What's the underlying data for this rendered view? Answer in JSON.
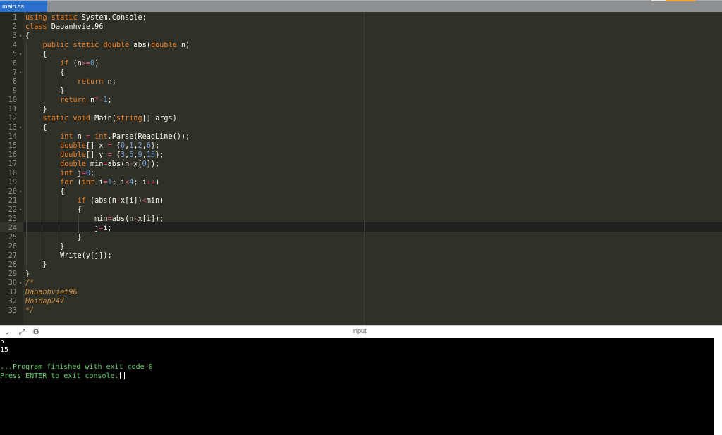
{
  "tabs": [
    {
      "label": "main.cs",
      "active": true
    }
  ],
  "colors": {
    "editor_bg": "#2f3129",
    "gutter_bg": "#272822",
    "keyword": "#ec7a1a",
    "number": "#6f9ad8",
    "operator": "#cf4a79",
    "comment": "#c98a3a",
    "tab_active": "#2b6fcc",
    "console_text": "#6cd26c"
  },
  "editor": {
    "active_line": 24,
    "lines": [
      {
        "n": "1",
        "fold": false,
        "indent": 0,
        "tokens": [
          [
            "kw",
            "using"
          ],
          [
            "pl",
            " "
          ],
          [
            "kw",
            "static"
          ],
          [
            "pl",
            " System.Console;"
          ]
        ]
      },
      {
        "n": "2",
        "fold": false,
        "indent": 0,
        "tokens": [
          [
            "kw",
            "class"
          ],
          [
            "pl",
            " Daoanhviet96"
          ]
        ]
      },
      {
        "n": "3",
        "fold": true,
        "indent": 0,
        "tokens": [
          [
            "pl",
            "{"
          ]
        ]
      },
      {
        "n": "4",
        "fold": false,
        "indent": 1,
        "tokens": [
          [
            "pl",
            "    "
          ],
          [
            "kw",
            "public"
          ],
          [
            "pl",
            " "
          ],
          [
            "kw",
            "static"
          ],
          [
            "pl",
            " "
          ],
          [
            "ty",
            "double"
          ],
          [
            "pl",
            " abs("
          ],
          [
            "ty",
            "double"
          ],
          [
            "pl",
            " n)"
          ]
        ]
      },
      {
        "n": "5",
        "fold": true,
        "indent": 1,
        "tokens": [
          [
            "pl",
            "    {"
          ]
        ]
      },
      {
        "n": "6",
        "fold": false,
        "indent": 2,
        "tokens": [
          [
            "pl",
            "        "
          ],
          [
            "kw",
            "if"
          ],
          [
            "pl",
            " (n"
          ],
          [
            "op",
            ">="
          ],
          [
            "nu",
            "0"
          ],
          [
            "pl",
            ")"
          ]
        ]
      },
      {
        "n": "7",
        "fold": true,
        "indent": 2,
        "tokens": [
          [
            "pl",
            "        {"
          ]
        ]
      },
      {
        "n": "8",
        "fold": false,
        "indent": 3,
        "tokens": [
          [
            "pl",
            "            "
          ],
          [
            "kw",
            "return"
          ],
          [
            "pl",
            " n;"
          ]
        ]
      },
      {
        "n": "9",
        "fold": false,
        "indent": 2,
        "tokens": [
          [
            "pl",
            "        }"
          ]
        ]
      },
      {
        "n": "10",
        "fold": false,
        "indent": 2,
        "tokens": [
          [
            "pl",
            "        "
          ],
          [
            "kw",
            "return"
          ],
          [
            "pl",
            " n"
          ],
          [
            "op",
            "*-"
          ],
          [
            "nu",
            "1"
          ],
          [
            "pl",
            ";"
          ]
        ]
      },
      {
        "n": "11",
        "fold": false,
        "indent": 1,
        "tokens": [
          [
            "pl",
            "    }"
          ]
        ]
      },
      {
        "n": "12",
        "fold": false,
        "indent": 1,
        "tokens": [
          [
            "pl",
            "    "
          ],
          [
            "kw",
            "static"
          ],
          [
            "pl",
            " "
          ],
          [
            "ty",
            "void"
          ],
          [
            "pl",
            " Main("
          ],
          [
            "ty",
            "string"
          ],
          [
            "pl",
            "[] args)"
          ]
        ]
      },
      {
        "n": "13",
        "fold": true,
        "indent": 1,
        "tokens": [
          [
            "pl",
            "    {"
          ]
        ]
      },
      {
        "n": "14",
        "fold": false,
        "indent": 2,
        "tokens": [
          [
            "pl",
            "        "
          ],
          [
            "ty",
            "int"
          ],
          [
            "pl",
            " n "
          ],
          [
            "op",
            "="
          ],
          [
            "pl",
            " "
          ],
          [
            "ty",
            "int"
          ],
          [
            "pl",
            ".Parse(ReadLine());"
          ]
        ]
      },
      {
        "n": "15",
        "fold": false,
        "indent": 2,
        "tokens": [
          [
            "pl",
            "        "
          ],
          [
            "ty",
            "double"
          ],
          [
            "pl",
            "[] x "
          ],
          [
            "op",
            "="
          ],
          [
            "pl",
            " {"
          ],
          [
            "nu",
            "0"
          ],
          [
            "pl",
            ","
          ],
          [
            "nu",
            "1"
          ],
          [
            "pl",
            ","
          ],
          [
            "nu",
            "2"
          ],
          [
            "pl",
            ","
          ],
          [
            "nu",
            "6"
          ],
          [
            "pl",
            "};"
          ]
        ]
      },
      {
        "n": "16",
        "fold": false,
        "indent": 2,
        "tokens": [
          [
            "pl",
            "        "
          ],
          [
            "ty",
            "double"
          ],
          [
            "pl",
            "[] y "
          ],
          [
            "op",
            "="
          ],
          [
            "pl",
            " {"
          ],
          [
            "nu",
            "3"
          ],
          [
            "pl",
            ","
          ],
          [
            "nu",
            "5"
          ],
          [
            "pl",
            ","
          ],
          [
            "nu",
            "9"
          ],
          [
            "pl",
            ","
          ],
          [
            "nu",
            "15"
          ],
          [
            "pl",
            "};"
          ]
        ]
      },
      {
        "n": "17",
        "fold": false,
        "indent": 2,
        "tokens": [
          [
            "pl",
            "        "
          ],
          [
            "ty",
            "double"
          ],
          [
            "pl",
            " min"
          ],
          [
            "op",
            "="
          ],
          [
            "pl",
            "abs(n"
          ],
          [
            "op",
            "-"
          ],
          [
            "pl",
            "x["
          ],
          [
            "nu",
            "0"
          ],
          [
            "pl",
            "]);"
          ]
        ]
      },
      {
        "n": "18",
        "fold": false,
        "indent": 2,
        "tokens": [
          [
            "pl",
            "        "
          ],
          [
            "ty",
            "int"
          ],
          [
            "pl",
            " j"
          ],
          [
            "op",
            "="
          ],
          [
            "nu",
            "0"
          ],
          [
            "pl",
            ";"
          ]
        ]
      },
      {
        "n": "19",
        "fold": false,
        "indent": 2,
        "tokens": [
          [
            "pl",
            "        "
          ],
          [
            "kw",
            "for"
          ],
          [
            "pl",
            " ("
          ],
          [
            "ty",
            "int"
          ],
          [
            "pl",
            " i"
          ],
          [
            "op",
            "="
          ],
          [
            "nu",
            "1"
          ],
          [
            "pl",
            "; i"
          ],
          [
            "op",
            "<"
          ],
          [
            "nu",
            "4"
          ],
          [
            "pl",
            "; i"
          ],
          [
            "op",
            "++"
          ],
          [
            "pl",
            ")"
          ]
        ]
      },
      {
        "n": "20",
        "fold": true,
        "indent": 2,
        "tokens": [
          [
            "pl",
            "        {"
          ]
        ]
      },
      {
        "n": "21",
        "fold": false,
        "indent": 3,
        "tokens": [
          [
            "pl",
            "            "
          ],
          [
            "kw",
            "if"
          ],
          [
            "pl",
            " (abs(n"
          ],
          [
            "op",
            "-"
          ],
          [
            "pl",
            "x[i])"
          ],
          [
            "op",
            "<"
          ],
          [
            "pl",
            "min)"
          ]
        ]
      },
      {
        "n": "22",
        "fold": true,
        "indent": 3,
        "tokens": [
          [
            "pl",
            "            {"
          ]
        ]
      },
      {
        "n": "23",
        "fold": false,
        "indent": 4,
        "tokens": [
          [
            "pl",
            "                min"
          ],
          [
            "op",
            "="
          ],
          [
            "pl",
            "abs(n"
          ],
          [
            "op",
            "-"
          ],
          [
            "pl",
            "x[i]);"
          ]
        ]
      },
      {
        "n": "24",
        "fold": false,
        "indent": 4,
        "tokens": [
          [
            "pl",
            "                j"
          ],
          [
            "op",
            "="
          ],
          [
            "pl",
            "i;"
          ]
        ]
      },
      {
        "n": "25",
        "fold": false,
        "indent": 3,
        "tokens": [
          [
            "pl",
            "            }"
          ]
        ]
      },
      {
        "n": "26",
        "fold": false,
        "indent": 2,
        "tokens": [
          [
            "pl",
            "        }"
          ]
        ]
      },
      {
        "n": "27",
        "fold": false,
        "indent": 2,
        "tokens": [
          [
            "pl",
            "        Write(y[j]);"
          ]
        ]
      },
      {
        "n": "28",
        "fold": false,
        "indent": 1,
        "tokens": [
          [
            "pl",
            "    }"
          ]
        ]
      },
      {
        "n": "29",
        "fold": false,
        "indent": 0,
        "tokens": [
          [
            "pl",
            "}"
          ]
        ]
      },
      {
        "n": "30",
        "fold": true,
        "indent": 0,
        "tokens": [
          [
            "cm",
            "/*"
          ]
        ]
      },
      {
        "n": "31",
        "fold": false,
        "indent": 0,
        "tokens": [
          [
            "cm",
            "Daoanhviet96"
          ]
        ]
      },
      {
        "n": "32",
        "fold": false,
        "indent": 0,
        "tokens": [
          [
            "cm",
            "Hoidap247"
          ]
        ]
      },
      {
        "n": "33",
        "fold": false,
        "indent": 0,
        "tokens": [
          [
            "cm",
            "*/"
          ]
        ]
      }
    ]
  },
  "console_toolbar": {
    "title": "input",
    "icons": [
      "chevron-down-icon",
      "expand-icon",
      "settings-icon"
    ]
  },
  "console": {
    "lines": [
      {
        "text": "5",
        "color": "white"
      },
      {
        "text": "15",
        "color": "white"
      },
      {
        "text": "",
        "color": "white"
      },
      {
        "text": "...Program finished with exit code 0",
        "color": "green"
      },
      {
        "text": "Press ENTER to exit console.",
        "color": "green",
        "cursor": true
      }
    ]
  }
}
